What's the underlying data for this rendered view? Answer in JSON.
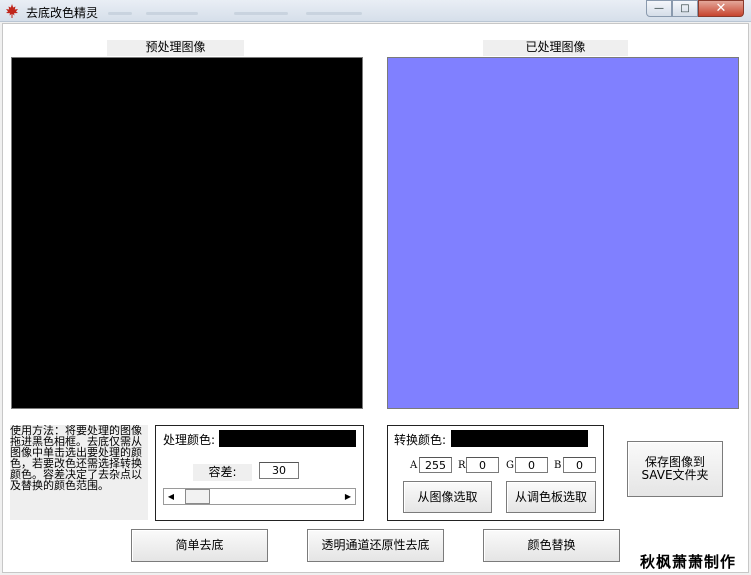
{
  "window": {
    "title": "去底改色精灵",
    "min_glyph": "—",
    "max_glyph": "□",
    "close_glyph": "✕"
  },
  "panels": {
    "preprocess_label": "预处理图像",
    "processed_label": "已处理图像",
    "preprocess_color": "#000000",
    "processed_color": "#8080ff"
  },
  "instructions": "使用方法：将要处理的图像拖进黑色相框。去底仅需从图像中单击选出要处理的颜色，若要改色还需选择转换颜色。容差决定了去杂点以及替换的颜色范围。",
  "process_group": {
    "color_label": "处理颜色:",
    "color_value": "#000000",
    "tolerance_label": "容差:",
    "tolerance_value": "30",
    "slider_value_fraction": 0.05,
    "slider_left_glyph": "◀",
    "slider_right_glyph": "▶"
  },
  "convert_group": {
    "color_label": "转换颜色:",
    "color_value": "#000000",
    "channels": [
      {
        "label": "A",
        "value": "255"
      },
      {
        "label": "R",
        "value": "0"
      },
      {
        "label": "G",
        "value": "0"
      },
      {
        "label": "B",
        "value": "0"
      }
    ],
    "pick_from_image": "从图像选取",
    "pick_from_palette": "从调色板选取"
  },
  "buttons": {
    "save": "保存图像到SAVE文件夹",
    "simple_remove": "简单去底",
    "alpha_restore": "透明通道还原性去底",
    "color_replace": "颜色替换"
  },
  "credit": "秋枫萧萧制作"
}
